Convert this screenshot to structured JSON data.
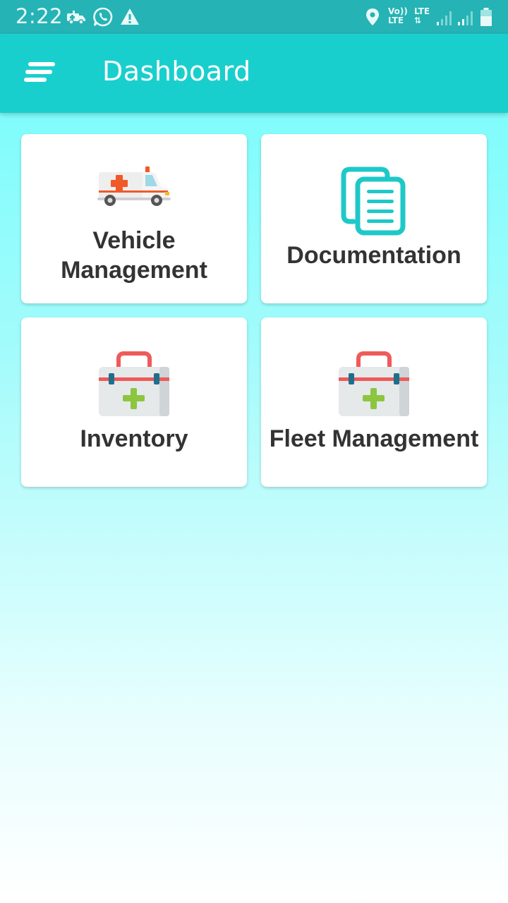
{
  "status_bar": {
    "time": "2:22",
    "left_icons": [
      "ambulance-notification-icon",
      "whatsapp-icon",
      "warning-icon"
    ],
    "right_icons": [
      "location-icon",
      "volte-icon",
      "lte-data-icon",
      "signal-1-icon",
      "signal-2-icon",
      "battery-icon"
    ],
    "volte_line1": "Vo))",
    "volte_line2": "LTE",
    "lte_label": "LTE"
  },
  "app_bar": {
    "title": "Dashboard",
    "menu_icon": "menu-icon"
  },
  "cards": [
    {
      "id": "vehicle-management",
      "label": "Vehicle Management",
      "icon": "ambulance-icon"
    },
    {
      "id": "documentation",
      "label": "Documentation",
      "icon": "documents-icon"
    },
    {
      "id": "inventory",
      "label": "Inventory",
      "icon": "first-aid-kit-icon"
    },
    {
      "id": "fleet-management",
      "label": "Fleet Management",
      "icon": "first-aid-kit-icon"
    }
  ],
  "colors": {
    "status_bar": "#25b3b5",
    "app_bar": "#19cfcd",
    "background_top": "#6ffdfd",
    "background_bottom": "#ffffff",
    "card_text": "#333333",
    "doc_icon": "#1fc8c8"
  }
}
